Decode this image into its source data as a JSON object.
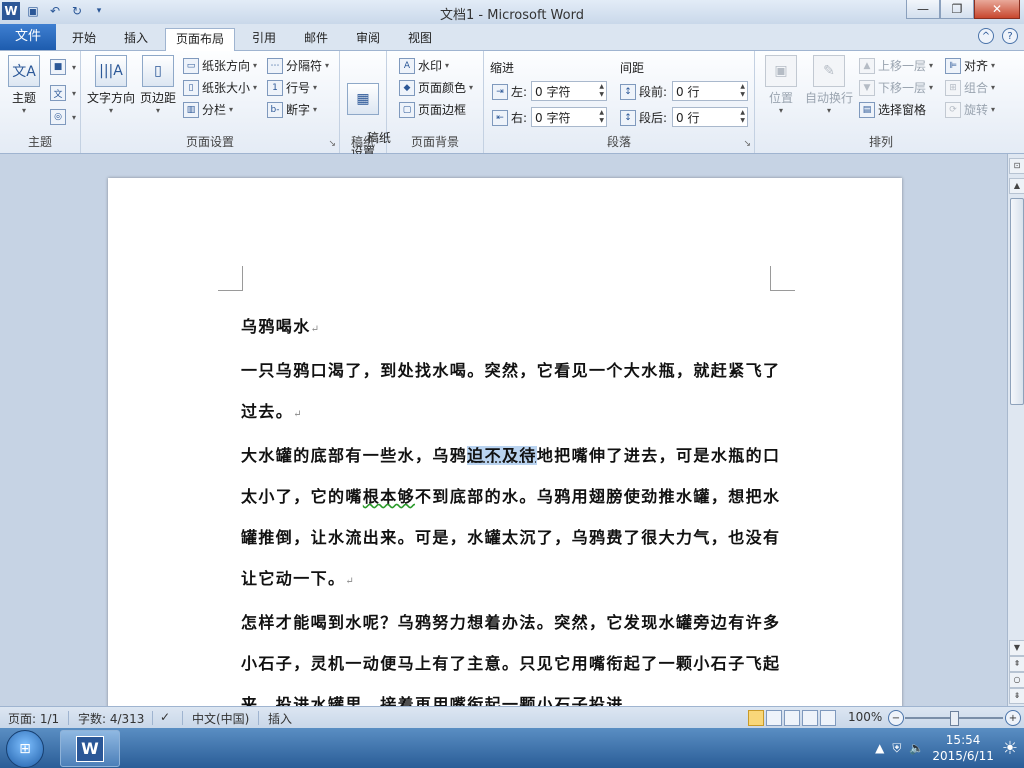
{
  "window": {
    "title": "文档1 - Microsoft Word",
    "app_icon": "word-icon",
    "quick_access": [
      "save-icon",
      "undo-icon",
      "redo-icon",
      "customize-icon"
    ]
  },
  "tabs": {
    "file": "文件",
    "items": [
      "开始",
      "插入",
      "页面布局",
      "引用",
      "邮件",
      "审阅",
      "视图"
    ],
    "active": "页面布局"
  },
  "ribbon": {
    "theme_group": {
      "label": "主题",
      "theme_btn": "主题"
    },
    "page_setup": {
      "label": "页面设置",
      "text_direction": "文字方向",
      "margins": "页边距",
      "orientation": "纸张方向",
      "size": "纸张大小",
      "columns": "分栏",
      "breaks": "分隔符",
      "line_numbers": "行号",
      "hyphenation": "断字"
    },
    "manuscript": {
      "label": "稿纸",
      "setting": "稿纸\n设置"
    },
    "background": {
      "label": "页面背景",
      "watermark": "水印",
      "page_color": "页面颜色",
      "page_borders": "页面边框"
    },
    "paragraph": {
      "label": "段落",
      "indent": "缩进",
      "spacing": "间距",
      "left_label": "左:",
      "left_value": "0 字符",
      "right_label": "右:",
      "right_value": "0 字符",
      "before_label": "段前:",
      "before_value": "0 行",
      "after_label": "段后:",
      "after_value": "0 行"
    },
    "arrange": {
      "label": "排列",
      "position": "位置",
      "wrap": "自动换行",
      "bring_forward": "上移一层",
      "send_backward": "下移一层",
      "selection_pane": "选择窗格",
      "align": "对齐",
      "group": "组合",
      "rotate": "旋转"
    }
  },
  "document": {
    "title": "乌鸦喝水",
    "p1": "一只乌鸦口渴了，到处找水喝。突然，它看见一个大水瓶，就赶紧飞了过去。",
    "p2_a": "大水罐的底部有一些水，乌鸦",
    "p2_sel": "迫不及待",
    "p2_b": "地把嘴伸了进去，可是水瓶的口太小了，它的嘴",
    "p2_squig": "根本够",
    "p2_c": "不到底部的水。乌鸦用翅膀使劲推水罐，想把水罐推倒，让水流出来。可是，水罐太沉了，乌鸦费了很大力气，也没有让它动一下。",
    "p3": "怎样才能喝到水呢？乌鸦努力想着办法。突然，它发现水罐旁边有许多小石子，灵机一动便马上有了主意。只见它用嘴衔起了一颗小石子飞起来，投进水罐里，接着再用嘴衔起一颗小石子投进",
    "para_mark": "↵"
  },
  "status": {
    "page": "页面: 1/1",
    "words": "字数: 4/313",
    "language": "中文(中国)",
    "mode": "插入",
    "zoom": "100%",
    "zoom_level_percent": 100
  },
  "taskbar": {
    "time": "15:54",
    "date": "2015/6/11"
  }
}
